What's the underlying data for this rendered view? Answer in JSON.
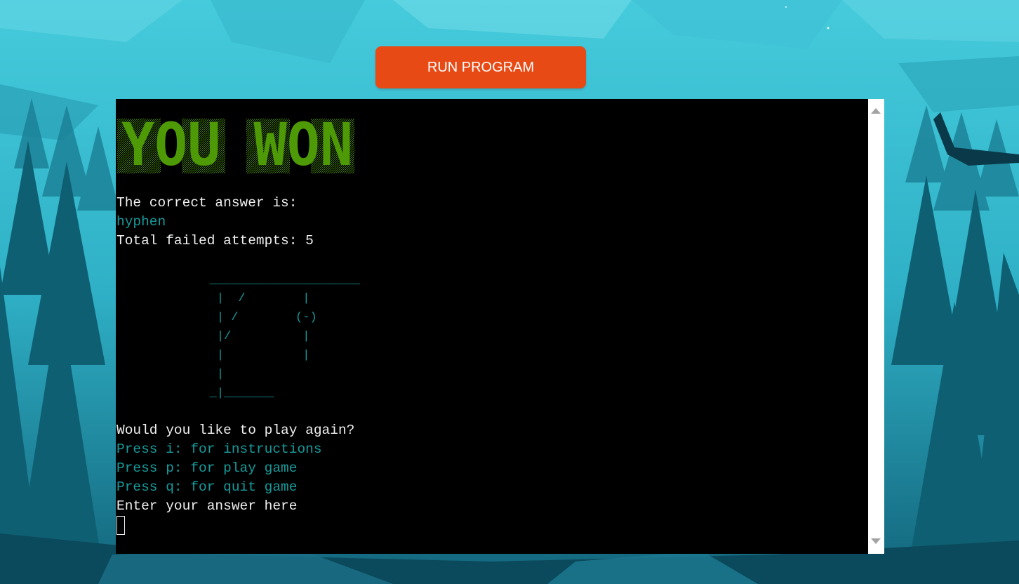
{
  "run_button": {
    "label": "RUN PROGRAM"
  },
  "terminal": {
    "banner_text": "YOU WON",
    "banner_color": "#4e9a06",
    "lines": {
      "correct_answer_label": "The correct answer is:",
      "answer_word": "hyphen",
      "failed_attempts": "Total failed attempts: 5",
      "play_again_prompt": "Would you like to play again?",
      "option_instructions": "Press i: for instructions",
      "option_play": "Press p: for play game",
      "option_quit": "Press q: for quit game",
      "answer_prompt": "Enter your answer here"
    },
    "gallows_art": [
      "             _____________________",
      "              |  /        |",
      "              | /        (-)",
      "              |/          |",
      "              |           |",
      "              |",
      "             _|_______"
    ],
    "input_value": ""
  },
  "colors": {
    "button": "#e84a16",
    "terminal_bg": "#000000",
    "text": "#f0f0f0",
    "accent_cyan": "#169b9b"
  }
}
